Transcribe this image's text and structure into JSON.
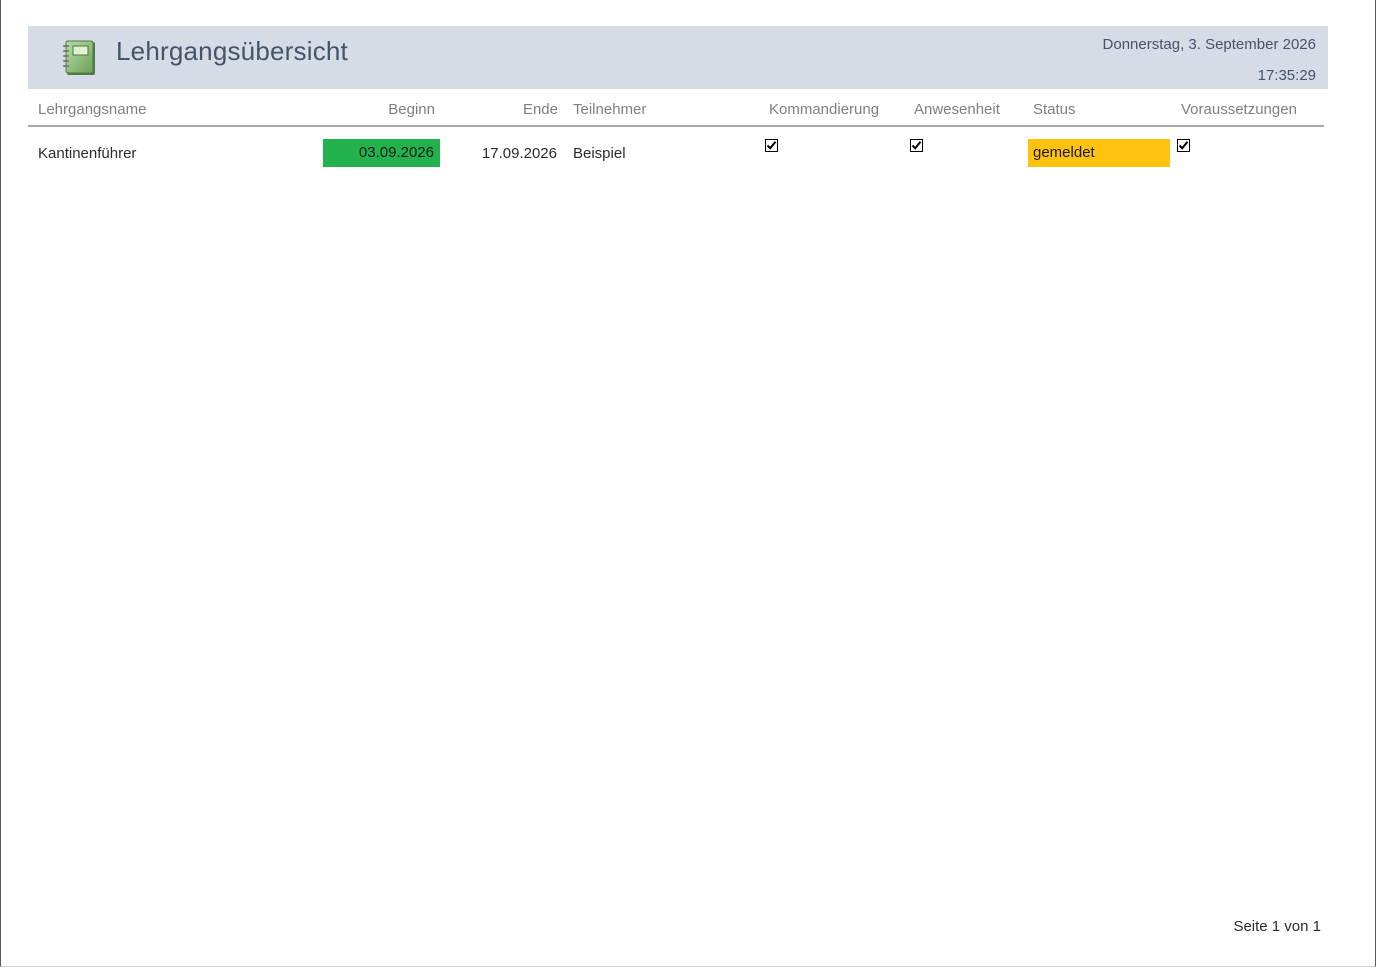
{
  "header": {
    "title": "Lehrgangsübersicht",
    "date": "Donnerstag, 3. September 2026",
    "time": "17:35:29",
    "icon": "notebook-icon"
  },
  "columns": {
    "name": "Lehrgangsname",
    "begin": "Beginn",
    "end": "Ende",
    "participant": "Teilnehmer",
    "assignment": "Kommandierung",
    "attendance": "Anwesenheit",
    "status": "Status",
    "prerequisites": "Voraussetzungen"
  },
  "rows": [
    {
      "name": "Kantinenführer",
      "begin": "03.09.2026",
      "end": "17.09.2026",
      "participant": "Beispiel",
      "assignment": true,
      "attendance": true,
      "status": "gemeldet",
      "prerequisites": true
    }
  ],
  "colors": {
    "header_band": "#d6dce5",
    "begin_highlight": "#22b14c",
    "status_highlight": "#ffc20e"
  },
  "footer": {
    "page_label": "Seite 1 von 1"
  }
}
